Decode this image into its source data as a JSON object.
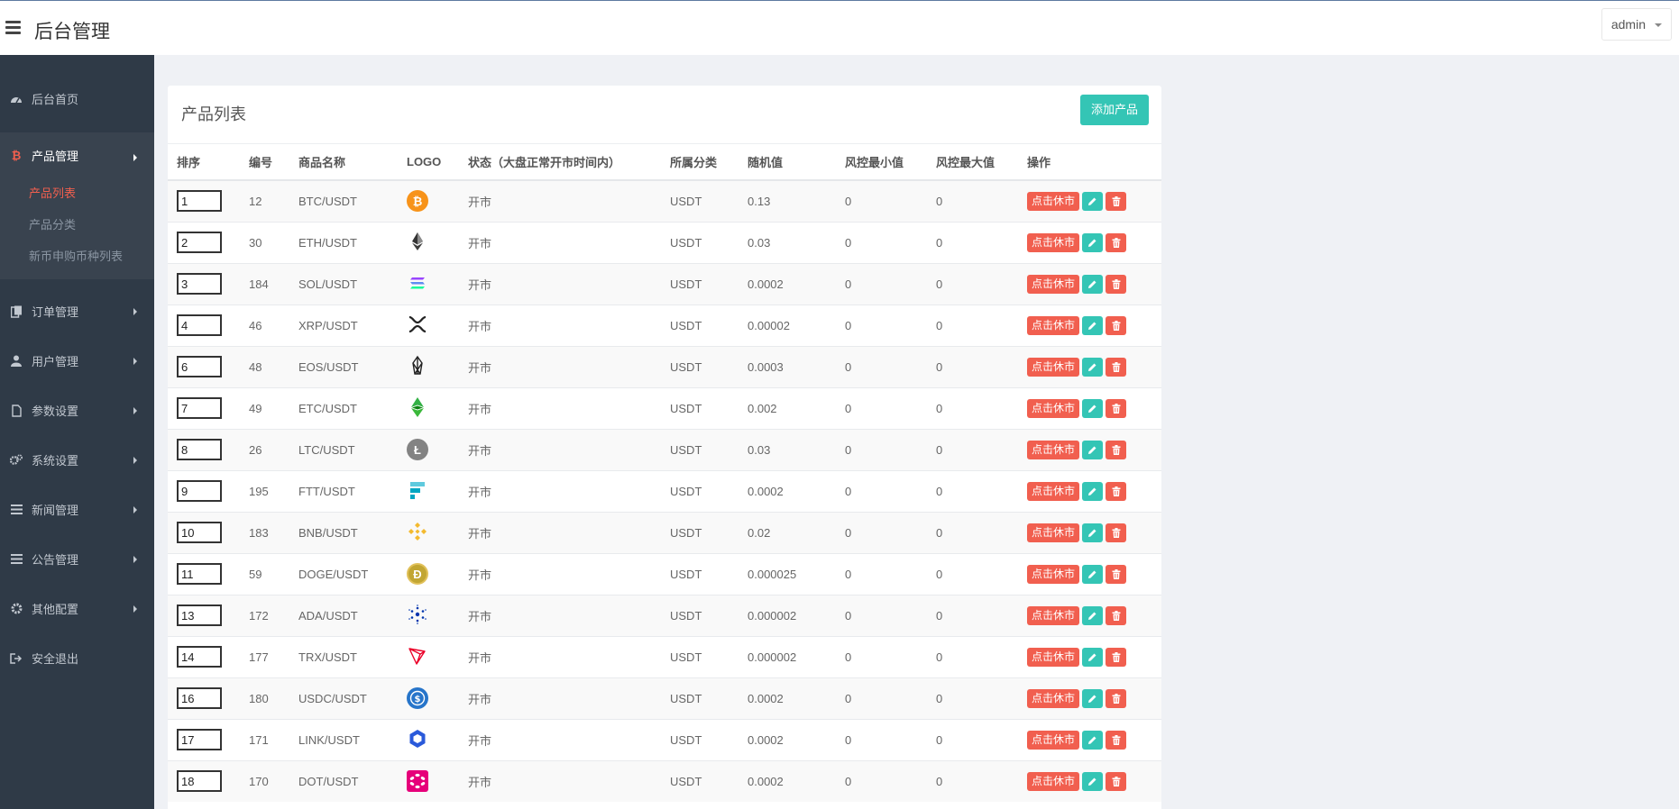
{
  "app": {
    "title": "后台管理",
    "user": "admin"
  },
  "sidebar": {
    "items": [
      {
        "label": "后台首页",
        "icon": "dashboard-icon"
      },
      {
        "label": "产品管理",
        "icon": "bitcoin-icon"
      },
      {
        "label": "订单管理",
        "icon": "copy-icon"
      },
      {
        "label": "用户管理",
        "icon": "user-icon"
      },
      {
        "label": "参数设置",
        "icon": "file-icon"
      },
      {
        "label": "系统设置",
        "icon": "gears-icon"
      },
      {
        "label": "新闻管理",
        "icon": "list-icon"
      },
      {
        "label": "公告管理",
        "icon": "list-icon"
      },
      {
        "label": "其他配置",
        "icon": "gear-icon"
      },
      {
        "label": "安全退出",
        "icon": "logout-icon"
      }
    ],
    "sub_items": [
      "产品列表",
      "产品分类",
      "新币申购币种列表"
    ]
  },
  "panel": {
    "title": "产品列表",
    "add_label": "添加产品"
  },
  "table": {
    "headers": [
      "排序",
      "编号",
      "商品名称",
      "LOGO",
      "状态（大盘正常开市时间内）",
      "所属分类",
      "随机值",
      "风控最小值",
      "风控最大值",
      "操作"
    ],
    "close_label": "点击休市",
    "rows": [
      {
        "sort": "1",
        "id": "12",
        "name": "BTC/USDT",
        "coin": "btc",
        "status": "开市",
        "category": "USDT",
        "random": "0.13",
        "min": "0",
        "max": "0"
      },
      {
        "sort": "2",
        "id": "30",
        "name": "ETH/USDT",
        "coin": "eth",
        "status": "开市",
        "category": "USDT",
        "random": "0.03",
        "min": "0",
        "max": "0"
      },
      {
        "sort": "3",
        "id": "184",
        "name": "SOL/USDT",
        "coin": "sol",
        "status": "开市",
        "category": "USDT",
        "random": "0.0002",
        "min": "0",
        "max": "0"
      },
      {
        "sort": "4",
        "id": "46",
        "name": "XRP/USDT",
        "coin": "xrp",
        "status": "开市",
        "category": "USDT",
        "random": "0.00002",
        "min": "0",
        "max": "0"
      },
      {
        "sort": "6",
        "id": "48",
        "name": "EOS/USDT",
        "coin": "eos",
        "status": "开市",
        "category": "USDT",
        "random": "0.0003",
        "min": "0",
        "max": "0"
      },
      {
        "sort": "7",
        "id": "49",
        "name": "ETC/USDT",
        "coin": "etc",
        "status": "开市",
        "category": "USDT",
        "random": "0.002",
        "min": "0",
        "max": "0"
      },
      {
        "sort": "8",
        "id": "26",
        "name": "LTC/USDT",
        "coin": "ltc",
        "status": "开市",
        "category": "USDT",
        "random": "0.03",
        "min": "0",
        "max": "0"
      },
      {
        "sort": "9",
        "id": "195",
        "name": "FTT/USDT",
        "coin": "ftt",
        "status": "开市",
        "category": "USDT",
        "random": "0.0002",
        "min": "0",
        "max": "0"
      },
      {
        "sort": "10",
        "id": "183",
        "name": "BNB/USDT",
        "coin": "bnb",
        "status": "开市",
        "category": "USDT",
        "random": "0.02",
        "min": "0",
        "max": "0"
      },
      {
        "sort": "11",
        "id": "59",
        "name": "DOGE/USDT",
        "coin": "doge",
        "status": "开市",
        "category": "USDT",
        "random": "0.000025",
        "min": "0",
        "max": "0"
      },
      {
        "sort": "13",
        "id": "172",
        "name": "ADA/USDT",
        "coin": "ada",
        "status": "开市",
        "category": "USDT",
        "random": "0.000002",
        "min": "0",
        "max": "0"
      },
      {
        "sort": "14",
        "id": "177",
        "name": "TRX/USDT",
        "coin": "trx",
        "status": "开市",
        "category": "USDT",
        "random": "0.000002",
        "min": "0",
        "max": "0"
      },
      {
        "sort": "16",
        "id": "180",
        "name": "USDC/USDT",
        "coin": "usdc",
        "status": "开市",
        "category": "USDT",
        "random": "0.0002",
        "min": "0",
        "max": "0"
      },
      {
        "sort": "17",
        "id": "171",
        "name": "LINK/USDT",
        "coin": "link",
        "status": "开市",
        "category": "USDT",
        "random": "0.0002",
        "min": "0",
        "max": "0"
      },
      {
        "sort": "18",
        "id": "170",
        "name": "DOT/USDT",
        "coin": "dot",
        "status": "开市",
        "category": "USDT",
        "random": "0.0002",
        "min": "0",
        "max": "0"
      }
    ]
  },
  "colors": {
    "sidebar_bg": "#2f3a47",
    "active": "#f15f4f",
    "accent": "#34c5b5",
    "danger": "#f15f4f"
  }
}
